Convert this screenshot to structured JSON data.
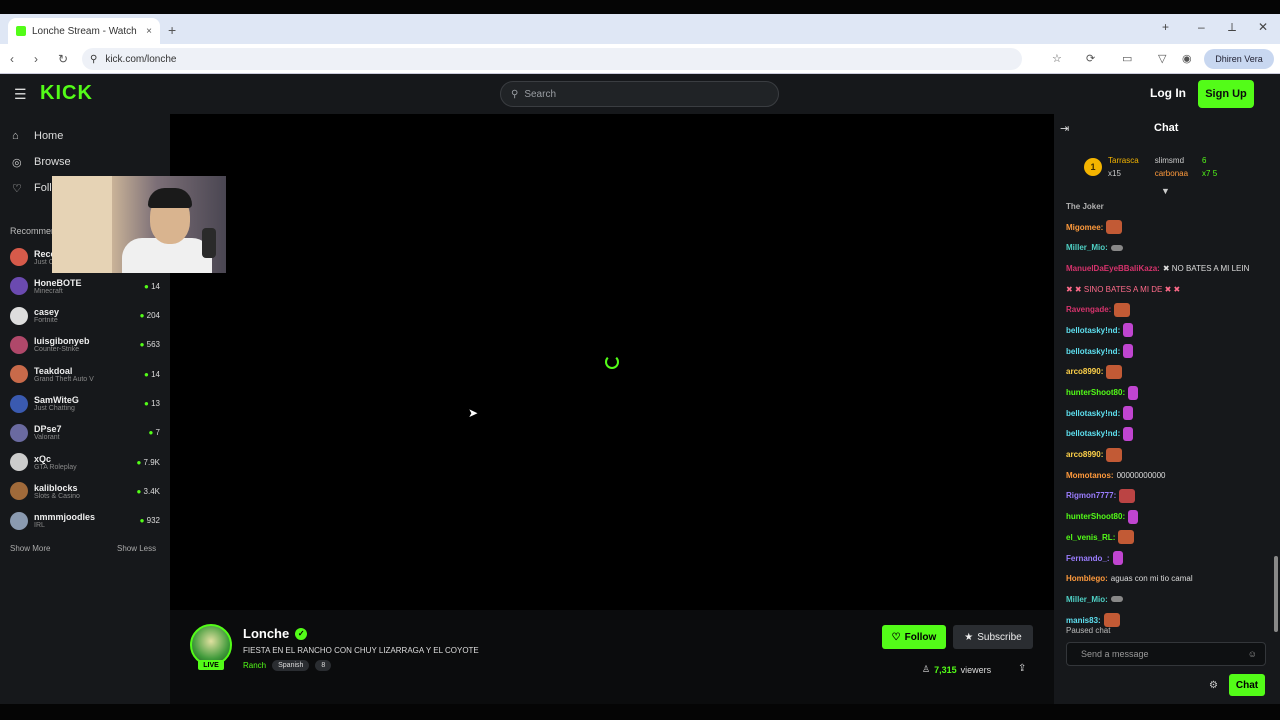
{
  "browser": {
    "tab_title": "Lonche Stream - Watch Live on Kick",
    "new_tab": "+",
    "tab_close": "×",
    "url": "kick.com/lonche",
    "window_controls": [
      "+",
      "–",
      "⟂",
      "✕"
    ],
    "profile_label": "Dhiren Vera"
  },
  "header": {
    "logo": "KICK",
    "search_placeholder": "Search",
    "login": "Log In",
    "signup": "Sign Up"
  },
  "sidebar": {
    "nav": [
      {
        "label": "Home",
        "icon": "home-icon"
      },
      {
        "label": "Browse",
        "icon": "compass-icon"
      },
      {
        "label": "Following",
        "icon": "heart-icon"
      }
    ],
    "recommended_title": "Recommended",
    "channels": [
      {
        "name": "Recommended",
        "game": "Just Chatting",
        "viewers": "",
        "color": "#d65a4a"
      },
      {
        "name": "HoneBOTE",
        "game": "Minecraft",
        "viewers": "14",
        "color": "#6b4ab0"
      },
      {
        "name": "casey",
        "game": "Fortnite",
        "viewers": "204",
        "color": "#dddddd"
      },
      {
        "name": "luisgibonyeb",
        "game": "Counter-Strike",
        "viewers": "563",
        "color": "#b0486a"
      },
      {
        "name": "Teakdoal",
        "game": "Grand Theft Auto V",
        "viewers": "14",
        "color": "#c86a4a"
      },
      {
        "name": "SamWiteG",
        "game": "Just Chatting",
        "viewers": "13",
        "color": "#3a5ab0"
      },
      {
        "name": "DPse7",
        "game": "Valorant",
        "viewers": "7",
        "color": "#6a6aa0"
      },
      {
        "name": "xQc",
        "game": "GTA Roleplay",
        "viewers": "7.9K",
        "color": "#cccccc"
      },
      {
        "name": "kaliblocks",
        "game": "Slots & Casino",
        "viewers": "3.4K",
        "color": "#a06a3a"
      },
      {
        "name": "nmmmjoodles",
        "game": "IRL",
        "viewers": "932",
        "color": "#8a9ab0"
      }
    ],
    "show_more": "Show More",
    "show_less": "Show Less"
  },
  "stream": {
    "name": "Lonche",
    "live_label": "LIVE",
    "title": "FIESTA EN EL RANCHO CON CHUY LIZARRAGA Y EL COYOTE",
    "category": "Ranch",
    "tags": [
      "Spanish",
      "8"
    ],
    "follow": "Follow",
    "subscribe": "Subscribe",
    "viewers_count": "7,315",
    "viewers_label": "viewers"
  },
  "chat": {
    "title": "Chat",
    "leaderboard": {
      "rank": "1",
      "first_name": "Tarrasca",
      "first_sub": "x15",
      "second_name": "slimsmd",
      "second_val": "6",
      "third_name": "carbonaa",
      "third_val": "x7 5"
    },
    "messages": [
      {
        "user": "The Joker",
        "text": "",
        "color": "#b0b0b0",
        "emote": ""
      },
      {
        "user": "Migomee:",
        "text": "",
        "color": "#ff9a3c",
        "emote": "em-face"
      },
      {
        "user": "Miller_Mio:",
        "text": "",
        "color": "#4fd1c5",
        "emote": "em-knife"
      },
      {
        "user": "ManuelDaEyeBBaliKaza:",
        "text": "✖ NO BATES A MI LEIN",
        "color": "#d6336c",
        "emote": ""
      },
      {
        "user": "",
        "text": "✖ ✖ SINO BATES A MI DE ✖ ✖",
        "color": "#ddd",
        "emote": ""
      },
      {
        "user": "Ravengade:",
        "text": "",
        "color": "#d6336c",
        "emote": "em-face"
      },
      {
        "user": "bellotasky!nd:",
        "text": "",
        "color": "#5ee0f0",
        "emote": "em-feather"
      },
      {
        "user": "bellotasky!nd:",
        "text": "",
        "color": "#5ee0f0",
        "emote": "em-feather"
      },
      {
        "user": "arco8990:",
        "text": "",
        "color": "#ffd24a",
        "emote": "em-face"
      },
      {
        "user": "hunterShoot80:",
        "text": "",
        "color": "#53fc18",
        "emote": "em-feather"
      },
      {
        "user": "bellotasky!nd:",
        "text": "",
        "color": "#5ee0f0",
        "emote": "em-feather"
      },
      {
        "user": "bellotasky!nd:",
        "text": "",
        "color": "#5ee0f0",
        "emote": "em-feather"
      },
      {
        "user": "arco8990:",
        "text": "",
        "color": "#ffd24a",
        "emote": "em-face"
      },
      {
        "user": "Momotanos:",
        "text": "00000000000",
        "color": "#ff9a3c",
        "emote": ""
      },
      {
        "user": "Rigmon7777:",
        "text": "",
        "color": "#9b7dff",
        "emote": "em-wild"
      },
      {
        "user": "hunterShoot80:",
        "text": "",
        "color": "#53fc18",
        "emote": "em-feather"
      },
      {
        "user": "el_venis_RL:",
        "text": "",
        "color": "#53fc18",
        "emote": "em-face"
      },
      {
        "user": "Fernando_:",
        "text": "",
        "color": "#9b7dff",
        "emote": "em-feather"
      },
      {
        "user": "Homblego:",
        "text": "aguas con mi tio camal",
        "color": "#ff9a3c",
        "emote": ""
      },
      {
        "user": "Miller_Mio:",
        "text": "",
        "color": "#4fd1c5",
        "emote": "em-knife"
      },
      {
        "user": "manis83:",
        "text": "",
        "color": "#5ee0f0",
        "emote": "em-face"
      }
    ],
    "paused_label": "Paused chat",
    "input_placeholder": "Send a message",
    "chat_button": "Chat"
  }
}
